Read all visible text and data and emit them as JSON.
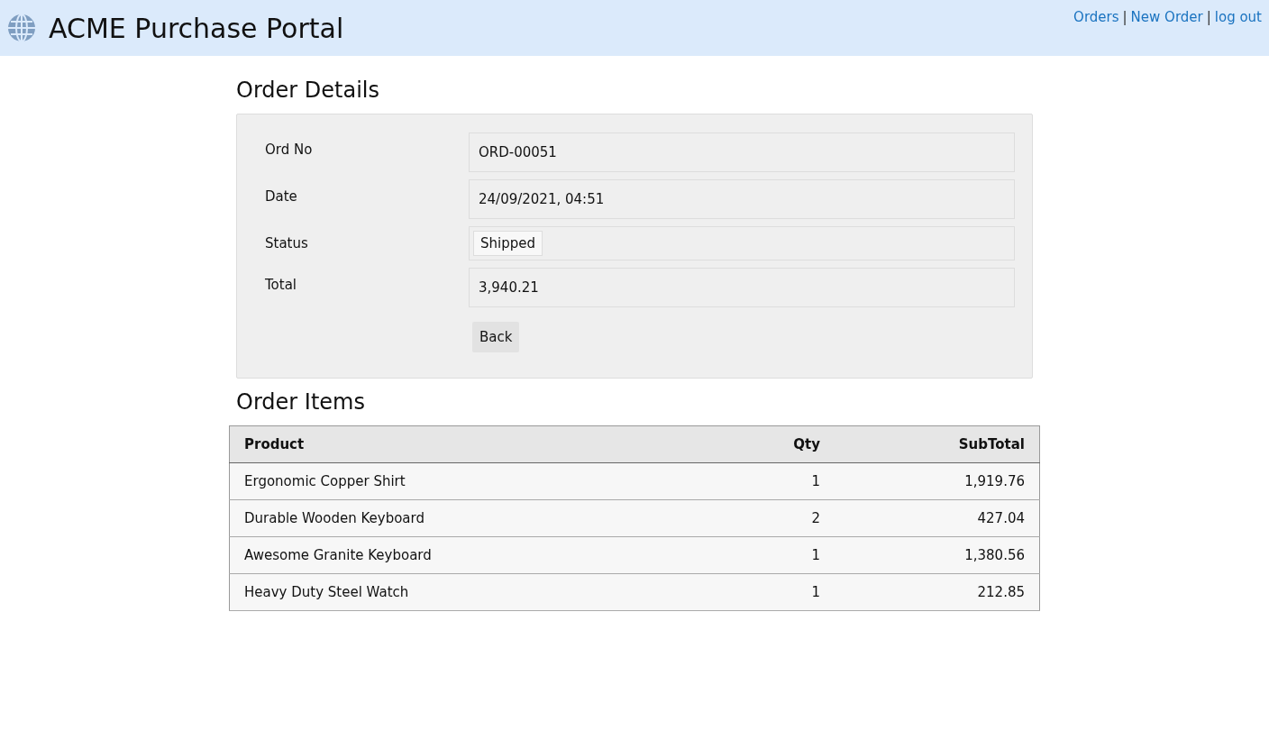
{
  "header": {
    "title": "ACME Purchase Portal",
    "nav": [
      {
        "kind": "link",
        "label": "Orders"
      },
      {
        "kind": "separator",
        "label": "|"
      },
      {
        "kind": "link",
        "label": "New Order"
      },
      {
        "kind": "separator",
        "label": "|"
      },
      {
        "kind": "link",
        "label": "log out"
      }
    ]
  },
  "details": {
    "heading": "Order Details",
    "fields": [
      {
        "kind": "text",
        "label": "Ord No",
        "value": "ORD-00051"
      },
      {
        "kind": "text",
        "label": "Date",
        "value": "24/09/2021, 04:51"
      },
      {
        "kind": "badge",
        "label": "Status",
        "value": "Shipped"
      },
      {
        "kind": "text",
        "label": "Total",
        "value": "3,940.21"
      }
    ],
    "button": "Back"
  },
  "items": {
    "heading": "Order Items",
    "columns": [
      "Product",
      "Qty",
      "SubTotal"
    ],
    "rows": [
      [
        "Ergonomic Copper Shirt",
        "1",
        "1,919.76"
      ],
      [
        "Durable Wooden Keyboard",
        "2",
        "427.04"
      ],
      [
        "Awesome Granite Keyboard",
        "1",
        "1,380.56"
      ],
      [
        "Heavy Duty Steel Watch",
        "1",
        "212.85"
      ]
    ]
  }
}
